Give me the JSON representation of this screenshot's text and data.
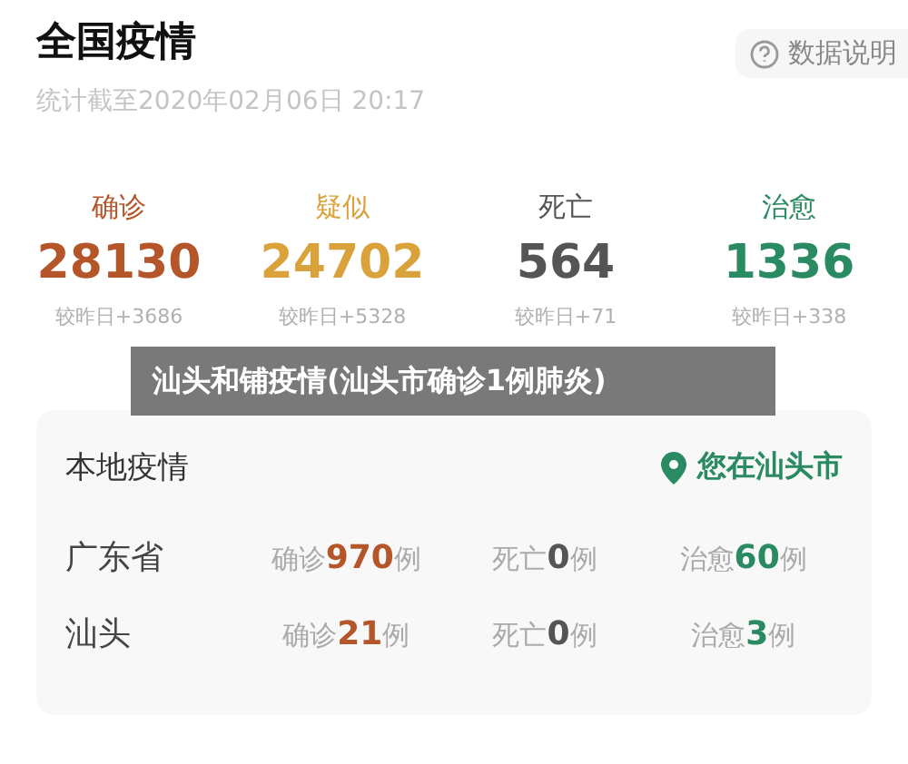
{
  "header": {
    "title": "全国疫情",
    "timestamp": "统计截至2020年02月06日 20:17",
    "help_button": "数据说明"
  },
  "summary": [
    {
      "label": "确诊",
      "value": "28130",
      "change": "较昨日+3686",
      "color": "#b5562a"
    },
    {
      "label": "疑似",
      "value": "24702",
      "change": "较昨日+5328",
      "color": "#d9a23a"
    },
    {
      "label": "死亡",
      "value": "564",
      "change": "较昨日+71",
      "color": "#555555"
    },
    {
      "label": "治愈",
      "value": "1336",
      "change": "较昨日+338",
      "color": "#2a8a62"
    }
  ],
  "caption": "汕头和铺疫情(汕头市确诊1例肺炎)",
  "local": {
    "title": "本地疫情",
    "location": "您在汕头市",
    "rows": [
      {
        "region": "广东省",
        "stats": [
          {
            "label": "确诊",
            "count": "970",
            "unit": "例",
            "color": "#b5562a"
          },
          {
            "label": "死亡",
            "count": "0",
            "unit": "例",
            "color": "#555555"
          },
          {
            "label": "治愈",
            "count": "60",
            "unit": "例",
            "color": "#2a8a62"
          }
        ]
      },
      {
        "region": "汕头",
        "stats": [
          {
            "label": "确诊",
            "count": "21",
            "unit": "例",
            "color": "#b5562a"
          },
          {
            "label": "死亡",
            "count": "0",
            "unit": "例",
            "color": "#555555"
          },
          {
            "label": "治愈",
            "count": "3",
            "unit": "例",
            "color": "#2a8a62"
          }
        ]
      }
    ]
  }
}
